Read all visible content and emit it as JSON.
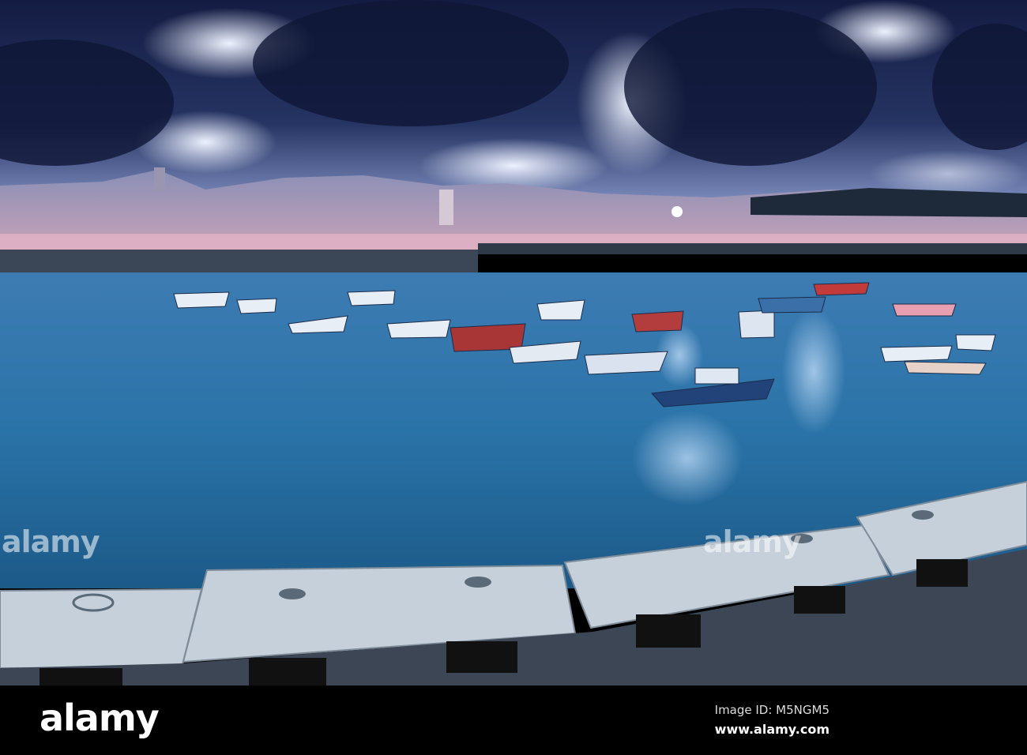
{
  "watermark": {
    "logo": "alamy",
    "image_id": "Image ID: M5NGM5",
    "site": "www.alamy.com"
  },
  "colors": {
    "sky": "#1c2550",
    "cloud_light": "#c9d3ee",
    "water": "#2a6fa3",
    "wall": "#c8d2dc",
    "footer": "#000000"
  }
}
